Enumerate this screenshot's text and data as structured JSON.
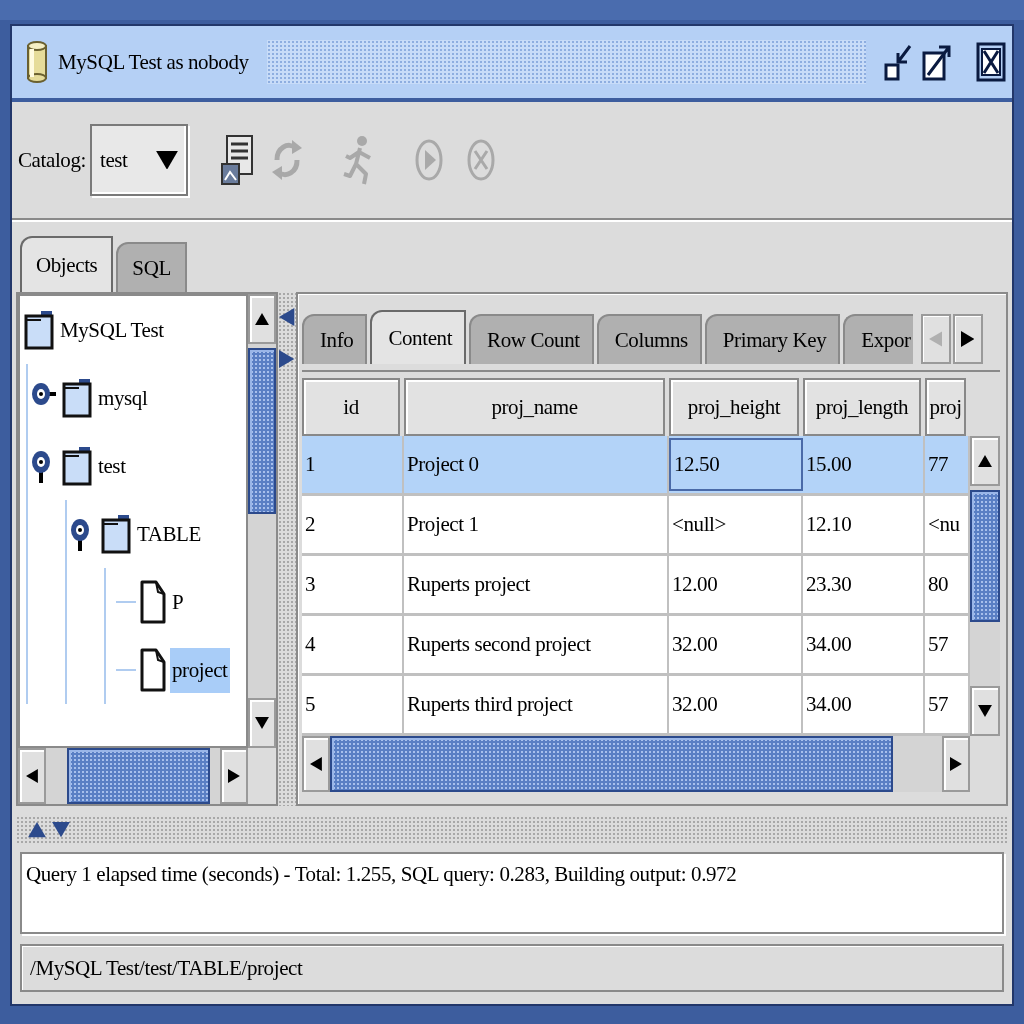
{
  "window": {
    "title": "MySQL Test as nobody"
  },
  "toolbar": {
    "catalog_label": "Catalog:",
    "catalog_value": "test",
    "buttons": [
      {
        "kind": "query",
        "disabled": false
      },
      {
        "kind": "refresh",
        "disabled": true
      },
      {
        "kind": "run",
        "disabled": true
      },
      {
        "kind": "play",
        "disabled": true
      },
      {
        "kind": "stop",
        "disabled": true
      }
    ]
  },
  "left_tabs": [
    {
      "label": "Objects",
      "selected": true
    },
    {
      "label": "SQL",
      "selected": false
    }
  ],
  "tree": {
    "label": "MySQL Test",
    "kind": "root",
    "selected": false,
    "children": [
      {
        "label": "mysql",
        "kind": "folder",
        "expanded": false,
        "selected": false
      },
      {
        "label": "test",
        "kind": "folder",
        "expanded": true,
        "selected": false,
        "children": [
          {
            "label": "TABLE",
            "kind": "folder",
            "expanded": true,
            "selected": false,
            "children": [
              {
                "label": "P",
                "kind": "table",
                "selected": false
              },
              {
                "label": "project",
                "kind": "table",
                "selected": true
              }
            ]
          }
        ]
      }
    ]
  },
  "right_tabs": [
    {
      "label": "Info",
      "selected": false
    },
    {
      "label": "Content",
      "selected": true
    },
    {
      "label": "Row Count",
      "selected": false
    },
    {
      "label": "Columns",
      "selected": false
    },
    {
      "label": "Primary Key",
      "selected": false
    },
    {
      "label": "Expor",
      "selected": false
    }
  ],
  "tab_scroll": [
    {
      "kind": "left",
      "disabled": true
    },
    {
      "kind": "right",
      "disabled": false
    }
  ],
  "table": {
    "columns": [
      "id",
      "proj_name",
      "proj_height",
      "proj_length",
      "proj"
    ],
    "rows": [
      {
        "selected": true,
        "cells": [
          {
            "text": "1",
            "focused": false
          },
          {
            "text": "Project 0",
            "focused": false
          },
          {
            "text": "12.50",
            "focused": true
          },
          {
            "text": "15.00",
            "focused": false
          },
          {
            "text": "77",
            "focused": false
          }
        ]
      },
      {
        "selected": false,
        "cells": [
          {
            "text": "2",
            "focused": false
          },
          {
            "text": "Project 1",
            "focused": false
          },
          {
            "text": "<null>",
            "focused": false
          },
          {
            "text": "12.10",
            "focused": false
          },
          {
            "text": "<nu",
            "focused": false
          }
        ]
      },
      {
        "selected": false,
        "cells": [
          {
            "text": "3",
            "focused": false
          },
          {
            "text": "Ruperts project",
            "focused": false
          },
          {
            "text": "12.00",
            "focused": false
          },
          {
            "text": "23.30",
            "focused": false
          },
          {
            "text": "80",
            "focused": false
          }
        ]
      },
      {
        "selected": false,
        "cells": [
          {
            "text": "4",
            "focused": false
          },
          {
            "text": "Ruperts second project",
            "focused": false
          },
          {
            "text": "32.00",
            "focused": false
          },
          {
            "text": "34.00",
            "focused": false
          },
          {
            "text": "57",
            "focused": false
          }
        ]
      },
      {
        "selected": false,
        "cells": [
          {
            "text": "5",
            "focused": false
          },
          {
            "text": "Ruperts third project",
            "focused": false
          },
          {
            "text": "32.00",
            "focused": false
          },
          {
            "text": "34.00",
            "focused": false
          },
          {
            "text": "57",
            "focused": false
          }
        ]
      }
    ]
  },
  "message": "Query 1 elapsed time (seconds) - Total: 1.255, SQL query: 0.283, Building output: 0.972",
  "status_bar": "/MySQL Test/test/TABLE/project"
}
